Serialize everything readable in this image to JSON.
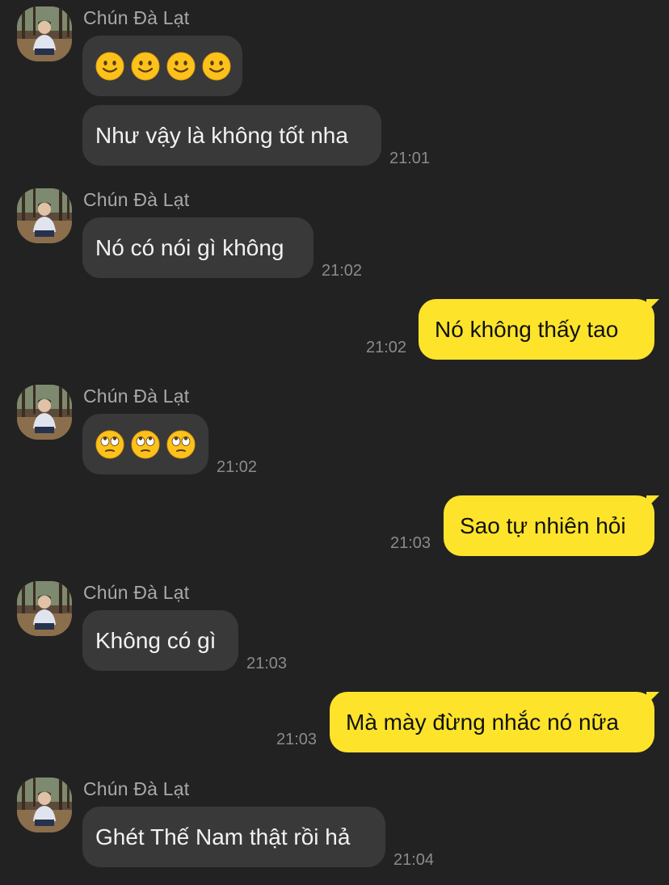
{
  "contact": {
    "name": "Chún Đà Lạt"
  },
  "messages": [
    {
      "sender": "contact",
      "type": "emoji",
      "emoji_name": "slightly-smiling-face",
      "emoji_count": 4,
      "time": ""
    },
    {
      "sender": "contact",
      "type": "text",
      "text": "Như vậy là không tốt nha",
      "time": "21:01"
    },
    {
      "sender": "contact",
      "type": "text",
      "text": "Nó có nói gì không",
      "time": "21:02"
    },
    {
      "sender": "me",
      "type": "text",
      "text": "Nó không thấy tao",
      "time": "21:02"
    },
    {
      "sender": "contact",
      "type": "emoji",
      "emoji_name": "face-with-rolling-eyes",
      "emoji_count": 3,
      "time": "21:02"
    },
    {
      "sender": "me",
      "type": "text",
      "text": "Sao tự nhiên hỏi",
      "time": "21:03"
    },
    {
      "sender": "contact",
      "type": "text",
      "text": "Không có gì",
      "time": "21:03"
    },
    {
      "sender": "me",
      "type": "text",
      "text": "Mà mày đừng nhắc nó nữa",
      "time": "21:03"
    },
    {
      "sender": "contact",
      "type": "text",
      "text": "Ghét Thế Nam thật rồi hả",
      "time": "21:04"
    }
  ],
  "colors": {
    "background": "#222222",
    "incoming_bubble": "#393939",
    "outgoing_bubble": "#fde42b",
    "sender_name": "#a9a9a9",
    "timestamp": "#8b8b8b"
  }
}
